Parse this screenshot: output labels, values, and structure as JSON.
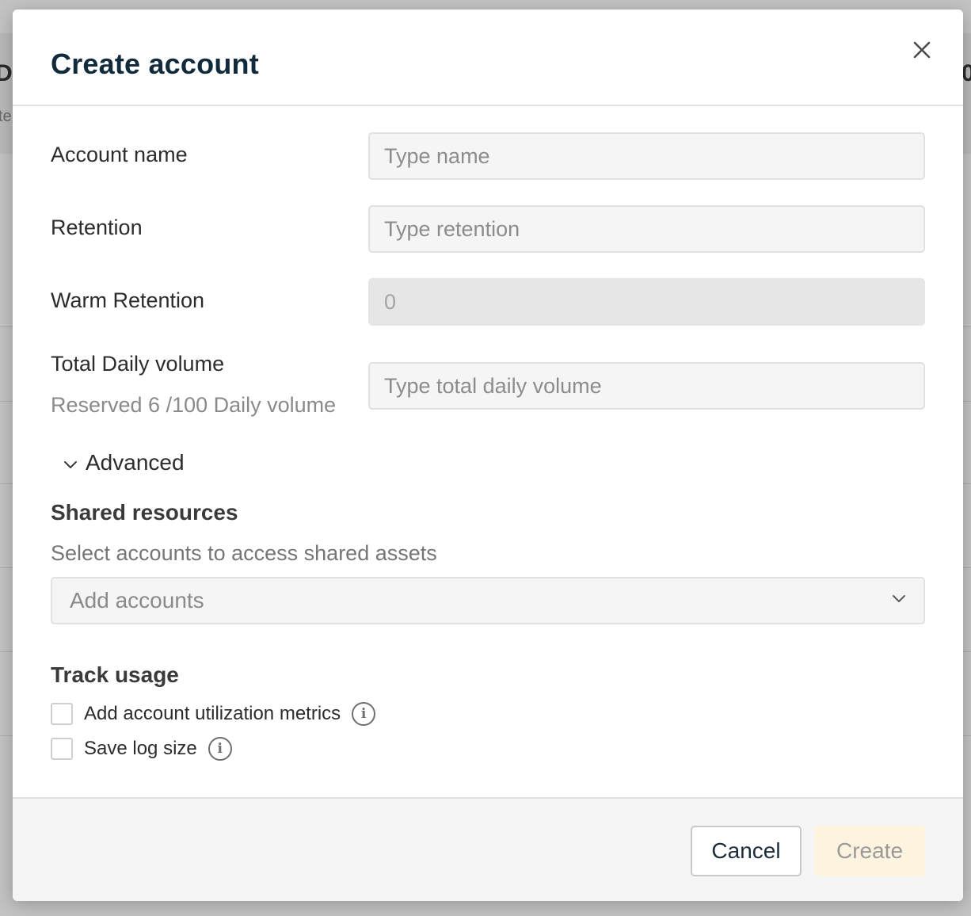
{
  "background": {
    "fragments": [
      "Da",
      "te",
      "0"
    ]
  },
  "modal": {
    "title": "Create account",
    "close_icon": "close-icon"
  },
  "form": {
    "account_name": {
      "label": "Account name",
      "placeholder": "Type name",
      "value": ""
    },
    "retention": {
      "label": "Retention",
      "placeholder": "Type retention",
      "value": ""
    },
    "warm_retention": {
      "label": "Warm Retention",
      "value": "0",
      "disabled": true
    },
    "total_daily_volume": {
      "label": "Total Daily volume",
      "sublabel": "Reserved 6 /100 Daily volume",
      "placeholder": "Type total daily volume",
      "value": ""
    },
    "advanced": {
      "label": "Advanced",
      "icon": "chevron-down-icon"
    }
  },
  "shared_resources": {
    "title": "Shared resources",
    "description": "Select accounts to access shared assets",
    "select_placeholder": "Add accounts",
    "select_icon": "chevron-down-icon"
  },
  "track_usage": {
    "title": "Track usage",
    "options": [
      {
        "label": "Add account utilization metrics",
        "checked": false,
        "icon": "info-icon"
      },
      {
        "label": "Save log size",
        "checked": false,
        "icon": "info-icon"
      }
    ]
  },
  "footer": {
    "cancel_label": "Cancel",
    "create_label": "Create"
  },
  "colors": {
    "title": "#112b3c",
    "create_button_bg": "#fdf3de",
    "input_bg": "#f5f5f5",
    "overlay": "#bdbdbd"
  }
}
